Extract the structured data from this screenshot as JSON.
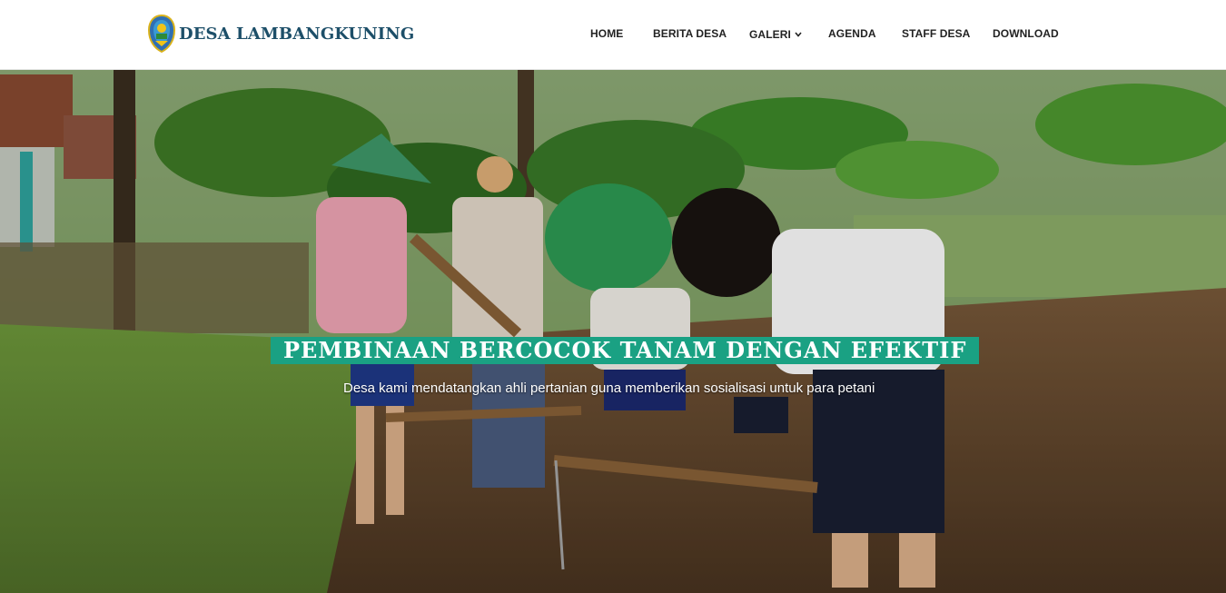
{
  "site": {
    "name": "DESA LAMBANGKUNING",
    "logo_icon": "village-emblem-icon"
  },
  "nav": {
    "items": [
      {
        "label": "HOME"
      },
      {
        "label": "BERITA DESA"
      },
      {
        "label": "GALERI",
        "has_dropdown": true,
        "icon": "chevron-down-icon"
      },
      {
        "label": "AGENDA"
      },
      {
        "label": "STAFF DESA"
      },
      {
        "label": "DOWNLOAD"
      }
    ]
  },
  "hero": {
    "title": "PEMBINAAN BERCOCOK TANAM DENGAN EFEKTIF",
    "subtitle": "Desa kami mendatangkan ahli pertanian guna memberikan sosialisasi untuk para petani",
    "image": "farmers-hoeing-field-photo"
  },
  "colors": {
    "accent": "#1aa183",
    "brand_text": "#1d4f69",
    "nav_text": "#222222"
  }
}
